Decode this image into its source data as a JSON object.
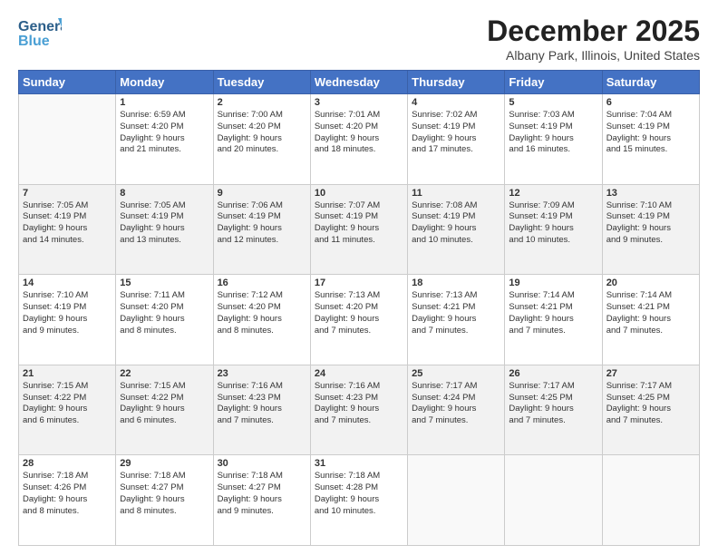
{
  "header": {
    "logo_line1": "General",
    "logo_line2": "Blue",
    "month_year": "December 2025",
    "location": "Albany Park, Illinois, United States"
  },
  "days_of_week": [
    "Sunday",
    "Monday",
    "Tuesday",
    "Wednesday",
    "Thursday",
    "Friday",
    "Saturday"
  ],
  "weeks": [
    [
      {
        "day": "",
        "content": ""
      },
      {
        "day": "1",
        "content": "Sunrise: 6:59 AM\nSunset: 4:20 PM\nDaylight: 9 hours\nand 21 minutes."
      },
      {
        "day": "2",
        "content": "Sunrise: 7:00 AM\nSunset: 4:20 PM\nDaylight: 9 hours\nand 20 minutes."
      },
      {
        "day": "3",
        "content": "Sunrise: 7:01 AM\nSunset: 4:20 PM\nDaylight: 9 hours\nand 18 minutes."
      },
      {
        "day": "4",
        "content": "Sunrise: 7:02 AM\nSunset: 4:19 PM\nDaylight: 9 hours\nand 17 minutes."
      },
      {
        "day": "5",
        "content": "Sunrise: 7:03 AM\nSunset: 4:19 PM\nDaylight: 9 hours\nand 16 minutes."
      },
      {
        "day": "6",
        "content": "Sunrise: 7:04 AM\nSunset: 4:19 PM\nDaylight: 9 hours\nand 15 minutes."
      }
    ],
    [
      {
        "day": "7",
        "content": "Sunrise: 7:05 AM\nSunset: 4:19 PM\nDaylight: 9 hours\nand 14 minutes."
      },
      {
        "day": "8",
        "content": "Sunrise: 7:05 AM\nSunset: 4:19 PM\nDaylight: 9 hours\nand 13 minutes."
      },
      {
        "day": "9",
        "content": "Sunrise: 7:06 AM\nSunset: 4:19 PM\nDaylight: 9 hours\nand 12 minutes."
      },
      {
        "day": "10",
        "content": "Sunrise: 7:07 AM\nSunset: 4:19 PM\nDaylight: 9 hours\nand 11 minutes."
      },
      {
        "day": "11",
        "content": "Sunrise: 7:08 AM\nSunset: 4:19 PM\nDaylight: 9 hours\nand 10 minutes."
      },
      {
        "day": "12",
        "content": "Sunrise: 7:09 AM\nSunset: 4:19 PM\nDaylight: 9 hours\nand 10 minutes."
      },
      {
        "day": "13",
        "content": "Sunrise: 7:10 AM\nSunset: 4:19 PM\nDaylight: 9 hours\nand 9 minutes."
      }
    ],
    [
      {
        "day": "14",
        "content": "Sunrise: 7:10 AM\nSunset: 4:19 PM\nDaylight: 9 hours\nand 9 minutes."
      },
      {
        "day": "15",
        "content": "Sunrise: 7:11 AM\nSunset: 4:20 PM\nDaylight: 9 hours\nand 8 minutes."
      },
      {
        "day": "16",
        "content": "Sunrise: 7:12 AM\nSunset: 4:20 PM\nDaylight: 9 hours\nand 8 minutes."
      },
      {
        "day": "17",
        "content": "Sunrise: 7:13 AM\nSunset: 4:20 PM\nDaylight: 9 hours\nand 7 minutes."
      },
      {
        "day": "18",
        "content": "Sunrise: 7:13 AM\nSunset: 4:21 PM\nDaylight: 9 hours\nand 7 minutes."
      },
      {
        "day": "19",
        "content": "Sunrise: 7:14 AM\nSunset: 4:21 PM\nDaylight: 9 hours\nand 7 minutes."
      },
      {
        "day": "20",
        "content": "Sunrise: 7:14 AM\nSunset: 4:21 PM\nDaylight: 9 hours\nand 7 minutes."
      }
    ],
    [
      {
        "day": "21",
        "content": "Sunrise: 7:15 AM\nSunset: 4:22 PM\nDaylight: 9 hours\nand 6 minutes."
      },
      {
        "day": "22",
        "content": "Sunrise: 7:15 AM\nSunset: 4:22 PM\nDaylight: 9 hours\nand 6 minutes."
      },
      {
        "day": "23",
        "content": "Sunrise: 7:16 AM\nSunset: 4:23 PM\nDaylight: 9 hours\nand 7 minutes."
      },
      {
        "day": "24",
        "content": "Sunrise: 7:16 AM\nSunset: 4:23 PM\nDaylight: 9 hours\nand 7 minutes."
      },
      {
        "day": "25",
        "content": "Sunrise: 7:17 AM\nSunset: 4:24 PM\nDaylight: 9 hours\nand 7 minutes."
      },
      {
        "day": "26",
        "content": "Sunrise: 7:17 AM\nSunset: 4:25 PM\nDaylight: 9 hours\nand 7 minutes."
      },
      {
        "day": "27",
        "content": "Sunrise: 7:17 AM\nSunset: 4:25 PM\nDaylight: 9 hours\nand 7 minutes."
      }
    ],
    [
      {
        "day": "28",
        "content": "Sunrise: 7:18 AM\nSunset: 4:26 PM\nDaylight: 9 hours\nand 8 minutes."
      },
      {
        "day": "29",
        "content": "Sunrise: 7:18 AM\nSunset: 4:27 PM\nDaylight: 9 hours\nand 8 minutes."
      },
      {
        "day": "30",
        "content": "Sunrise: 7:18 AM\nSunset: 4:27 PM\nDaylight: 9 hours\nand 9 minutes."
      },
      {
        "day": "31",
        "content": "Sunrise: 7:18 AM\nSunset: 4:28 PM\nDaylight: 9 hours\nand 10 minutes."
      },
      {
        "day": "",
        "content": ""
      },
      {
        "day": "",
        "content": ""
      },
      {
        "day": "",
        "content": ""
      }
    ]
  ]
}
